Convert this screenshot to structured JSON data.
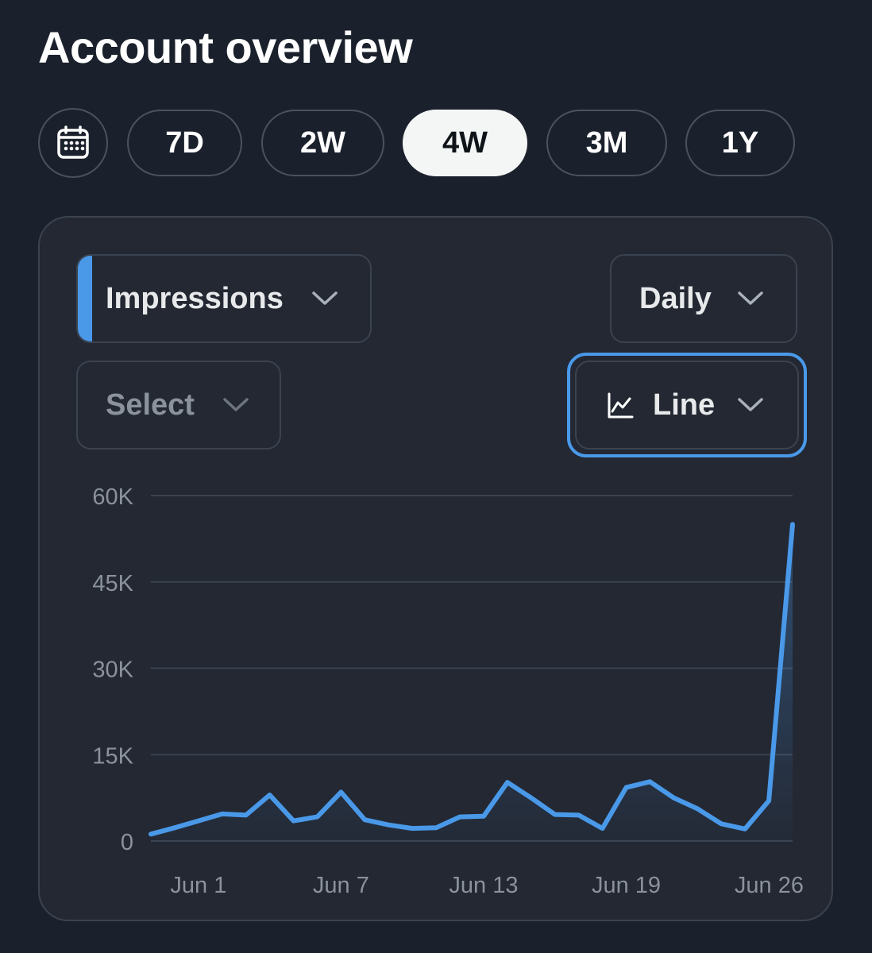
{
  "page": {
    "title": "Account overview"
  },
  "range_filters": [
    {
      "label": "7D",
      "active": false
    },
    {
      "label": "2W",
      "active": false
    },
    {
      "label": "4W",
      "active": true
    },
    {
      "label": "3M",
      "active": false
    },
    {
      "label": "1Y",
      "active": false
    }
  ],
  "icons": {
    "calendar": "calendar-icon",
    "chevron": "chevron-down-icon",
    "line_chart": "line-chart-icon"
  },
  "controls": {
    "metric_label": "Impressions",
    "compare_placeholder": "Select",
    "interval_label": "Daily",
    "chart_type_label": "Line"
  },
  "colors": {
    "accent": "#4a99e9",
    "background": "#1b212c",
    "card": "#232833",
    "grid": "#3b4350"
  },
  "chart_data": {
    "type": "line",
    "title": "",
    "xlabel": "",
    "ylabel": "",
    "ylim": [
      0,
      60000
    ],
    "yticks": [
      0,
      15000,
      30000,
      45000,
      60000
    ],
    "ytick_labels": [
      "0",
      "15K",
      "30K",
      "45K",
      "60K"
    ],
    "xtick_labels": [
      "Jun 1",
      "Jun 7",
      "Jun 13",
      "Jun 19",
      "Jun 26"
    ],
    "x": [
      "May 30",
      "May 31",
      "Jun 1",
      "Jun 2",
      "Jun 3",
      "Jun 4",
      "Jun 5",
      "Jun 6",
      "Jun 7",
      "Jun 8",
      "Jun 9",
      "Jun 10",
      "Jun 11",
      "Jun 12",
      "Jun 13",
      "Jun 14",
      "Jun 15",
      "Jun 16",
      "Jun 17",
      "Jun 18",
      "Jun 19",
      "Jun 20",
      "Jun 21",
      "Jun 22",
      "Jun 23",
      "Jun 24",
      "Jun 25",
      "Jun 26",
      "Jun 27"
    ],
    "series": [
      {
        "color": "#4a99e9",
        "values": [
          1200,
          2300,
          3500,
          4700,
          4500,
          8000,
          3500,
          4200,
          8500,
          3700,
          2800,
          2200,
          2300,
          4200,
          4300,
          10200,
          7500,
          4600,
          4500,
          2200,
          9300,
          10300,
          7500,
          5600,
          3000,
          2100,
          7000,
          55000
        ]
      }
    ],
    "grid": true,
    "legend": "none"
  }
}
